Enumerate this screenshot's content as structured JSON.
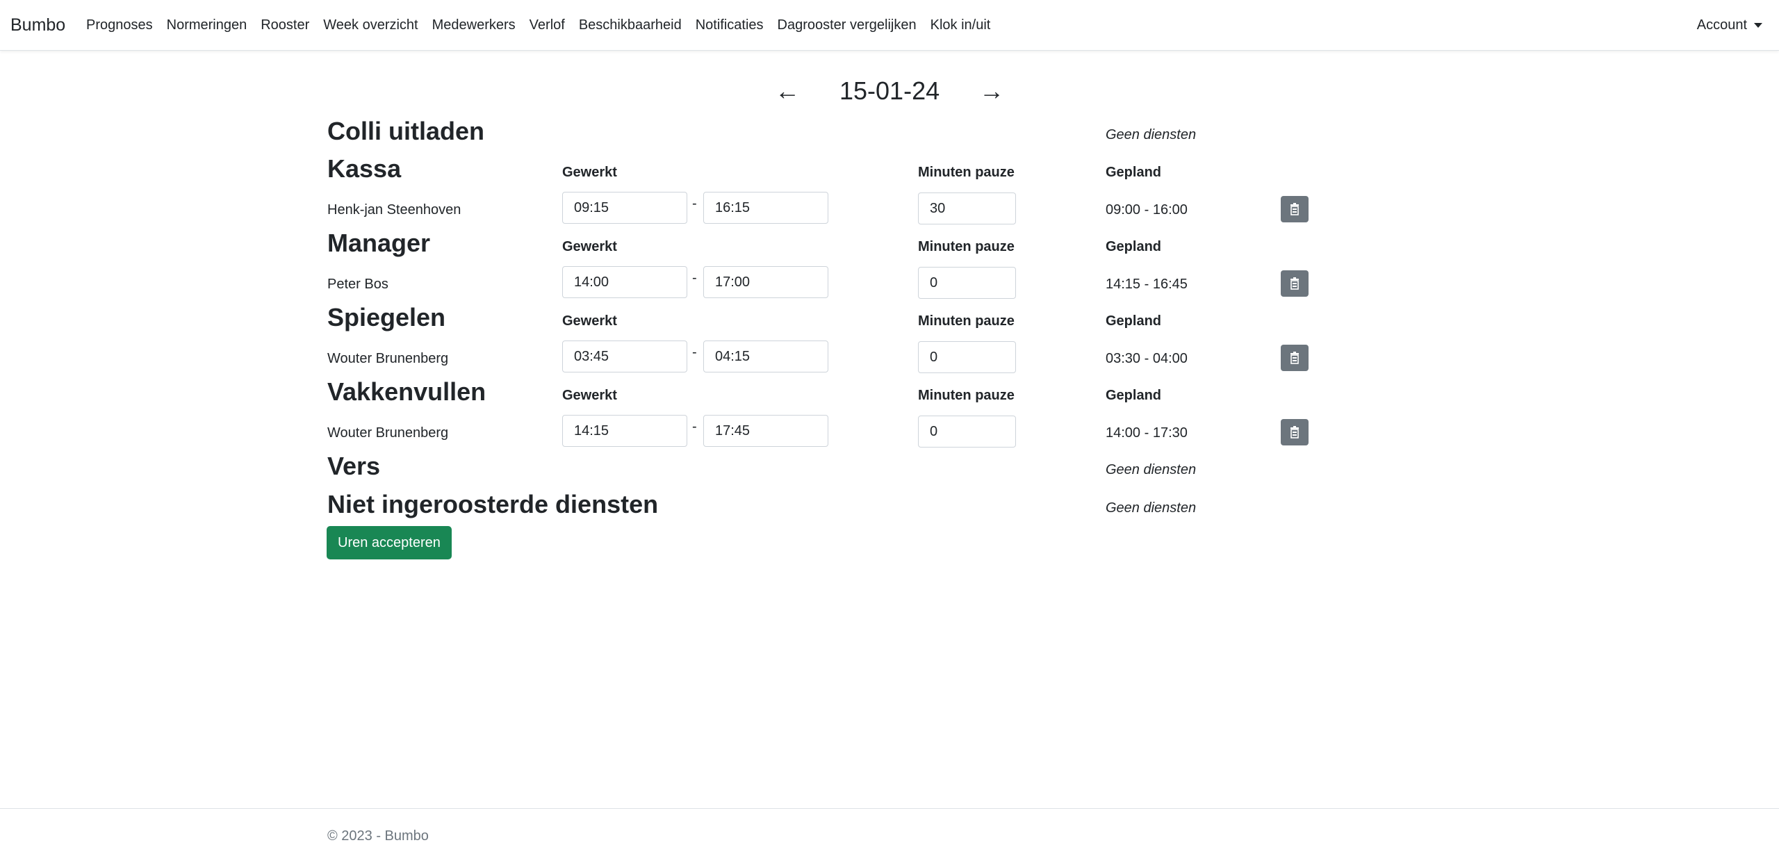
{
  "navbar": {
    "brand": "Bumbo",
    "links": [
      "Prognoses",
      "Normeringen",
      "Rooster",
      "Week overzicht",
      "Medewerkers",
      "Verlof",
      "Beschikbaarheid",
      "Notificaties",
      "Dagrooster vergelijken",
      "Klok in/uit"
    ],
    "account": "Account"
  },
  "date_nav": {
    "prev": "←",
    "date": "15-01-24",
    "next": "→"
  },
  "labels": {
    "worked": "Gewerkt",
    "pause": "Minuten pauze",
    "planned": "Gepland",
    "no_shifts": "Geen diensten",
    "dash": "-"
  },
  "sections": [
    {
      "title": "Colli uitladen"
    },
    {
      "title": "Kassa",
      "employee": "Henk-jan Steenhoven",
      "start": "09:15",
      "end": "16:15",
      "pause": "30",
      "planned": "09:00 - 16:00"
    },
    {
      "title": "Manager",
      "employee": "Peter Bos",
      "start": "14:00",
      "end": "17:00",
      "pause": "0",
      "planned": "14:15 - 16:45"
    },
    {
      "title": "Spiegelen",
      "employee": "Wouter Brunenberg",
      "start": "03:45",
      "end": "04:15",
      "pause": "0",
      "planned": "03:30 - 04:00"
    },
    {
      "title": "Vakkenvullen",
      "employee": "Wouter Brunenberg",
      "start": "14:15",
      "end": "17:45",
      "pause": "0",
      "planned": "14:00 - 17:30"
    },
    {
      "title": "Vers"
    },
    {
      "title": "Niet ingeroosterde diensten"
    }
  ],
  "accept_button": "Uren accepteren",
  "footer": "© 2023 - Bumbo",
  "colors": {
    "accept": "#198754",
    "delete": "#6c757d"
  }
}
